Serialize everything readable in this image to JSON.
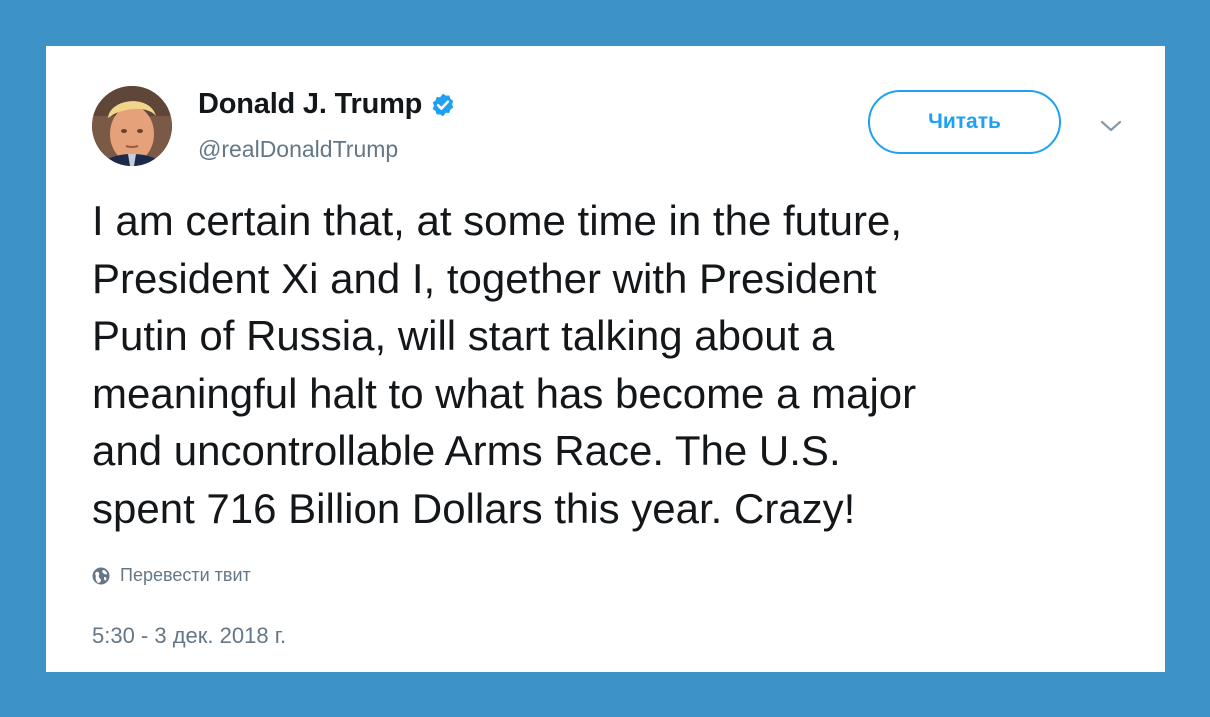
{
  "page": {
    "background_color": "#3d92c6",
    "card_color": "#ffffff"
  },
  "tweet": {
    "author": {
      "display_name": "Donald J. Trump",
      "handle": "@realDonaldTrump",
      "verified": true,
      "verified_icon": "verified-badge-icon",
      "avatar_icon": "profile-photo"
    },
    "follow_button_label": "Читать",
    "menu_icon": "chevron-down-icon",
    "text": "I am certain that, at some time in the future,\nPresident Xi and I, together with President\nPutin of Russia, will start talking about a\nmeaningful halt to what has become a major\nand uncontrollable Arms Race. The U.S.\nspent 716 Billion Dollars this year. Crazy!",
    "translate_label": "Перевести твит",
    "translate_icon": "globe-icon",
    "timestamp": "5:30 - 3 дек. 2018 г."
  },
  "colors": {
    "accent": "#1da1f2",
    "text_primary": "#14171a",
    "text_secondary": "#657786"
  }
}
